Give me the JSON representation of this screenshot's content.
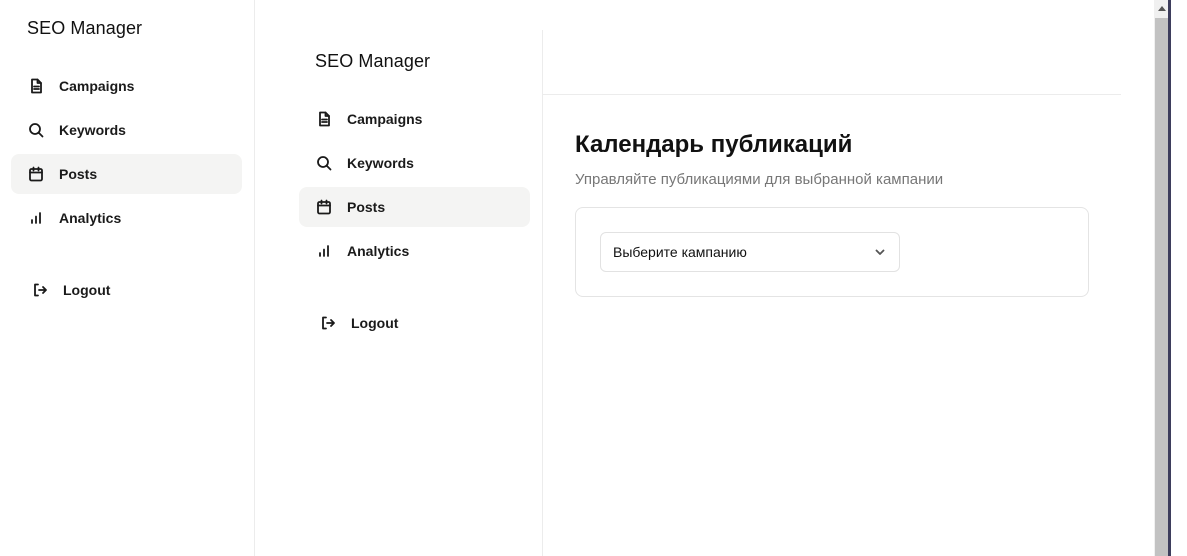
{
  "outer_sidebar": {
    "brand": "SEO Manager",
    "items": [
      {
        "label": "Campaigns",
        "icon": "document-icon"
      },
      {
        "label": "Keywords",
        "icon": "search-icon"
      },
      {
        "label": "Posts",
        "icon": "calendar-icon",
        "active": true
      },
      {
        "label": "Analytics",
        "icon": "bar-chart-icon"
      }
    ],
    "logout": "Logout"
  },
  "inner_sidebar": {
    "brand": "SEO Manager",
    "items": [
      {
        "label": "Campaigns",
        "icon": "document-icon"
      },
      {
        "label": "Keywords",
        "icon": "search-icon"
      },
      {
        "label": "Posts",
        "icon": "calendar-icon",
        "active": true
      },
      {
        "label": "Analytics",
        "icon": "bar-chart-icon"
      }
    ],
    "logout": "Logout"
  },
  "main": {
    "title": "Календарь публикаций",
    "subtitle": "Управляйте публикациями для выбранной кампании",
    "campaign_select": {
      "selected": "Выберите кампанию",
      "icon": "chevron-down-icon"
    }
  },
  "colors": {
    "active_bg": "#f4f4f3",
    "subtitle": "#777777",
    "border": "#ececec"
  }
}
